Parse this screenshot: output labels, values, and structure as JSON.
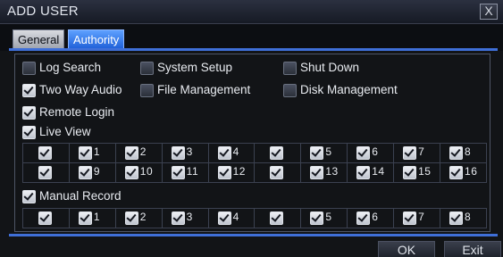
{
  "window": {
    "title": "ADD USER",
    "close_glyph": "X"
  },
  "tabs": [
    {
      "label": "General"
    },
    {
      "label": "Authority"
    }
  ],
  "options": {
    "log_search": {
      "label": "Log Search",
      "checked": false
    },
    "system_setup": {
      "label": "System Setup",
      "checked": false
    },
    "shut_down": {
      "label": "Shut Down",
      "checked": false
    },
    "two_way_audio": {
      "label": "Two Way Audio",
      "checked": true
    },
    "file_management": {
      "label": "File Management",
      "checked": false
    },
    "disk_management": {
      "label": "Disk Management",
      "checked": false
    },
    "remote_login": {
      "label": "Remote Login",
      "checked": true
    },
    "live_view": {
      "label": "Live View",
      "checked": true
    },
    "manual_record": {
      "label": "Manual Record",
      "checked": true
    }
  },
  "live_view_grid": {
    "row1": [
      "",
      "1",
      "2",
      "3",
      "4",
      "",
      "5",
      "6",
      "7",
      "8"
    ],
    "row2": [
      "",
      "9",
      "10",
      "11",
      "12",
      "",
      "13",
      "14",
      "15",
      "16"
    ]
  },
  "manual_record_grid": {
    "row1": [
      "",
      "1",
      "2",
      "3",
      "4",
      "",
      "5",
      "6",
      "7",
      "8"
    ]
  },
  "buttons": {
    "ok": "OK",
    "exit": "Exit"
  },
  "icons": {
    "close": "close-icon",
    "scroll_up": "scroll-up-icon",
    "scroll_down": "scroll-down-icon",
    "check": "checkbox-icon"
  },
  "colors": {
    "accent": "#3f6fd8",
    "tab_active": "#1e5fd8"
  }
}
